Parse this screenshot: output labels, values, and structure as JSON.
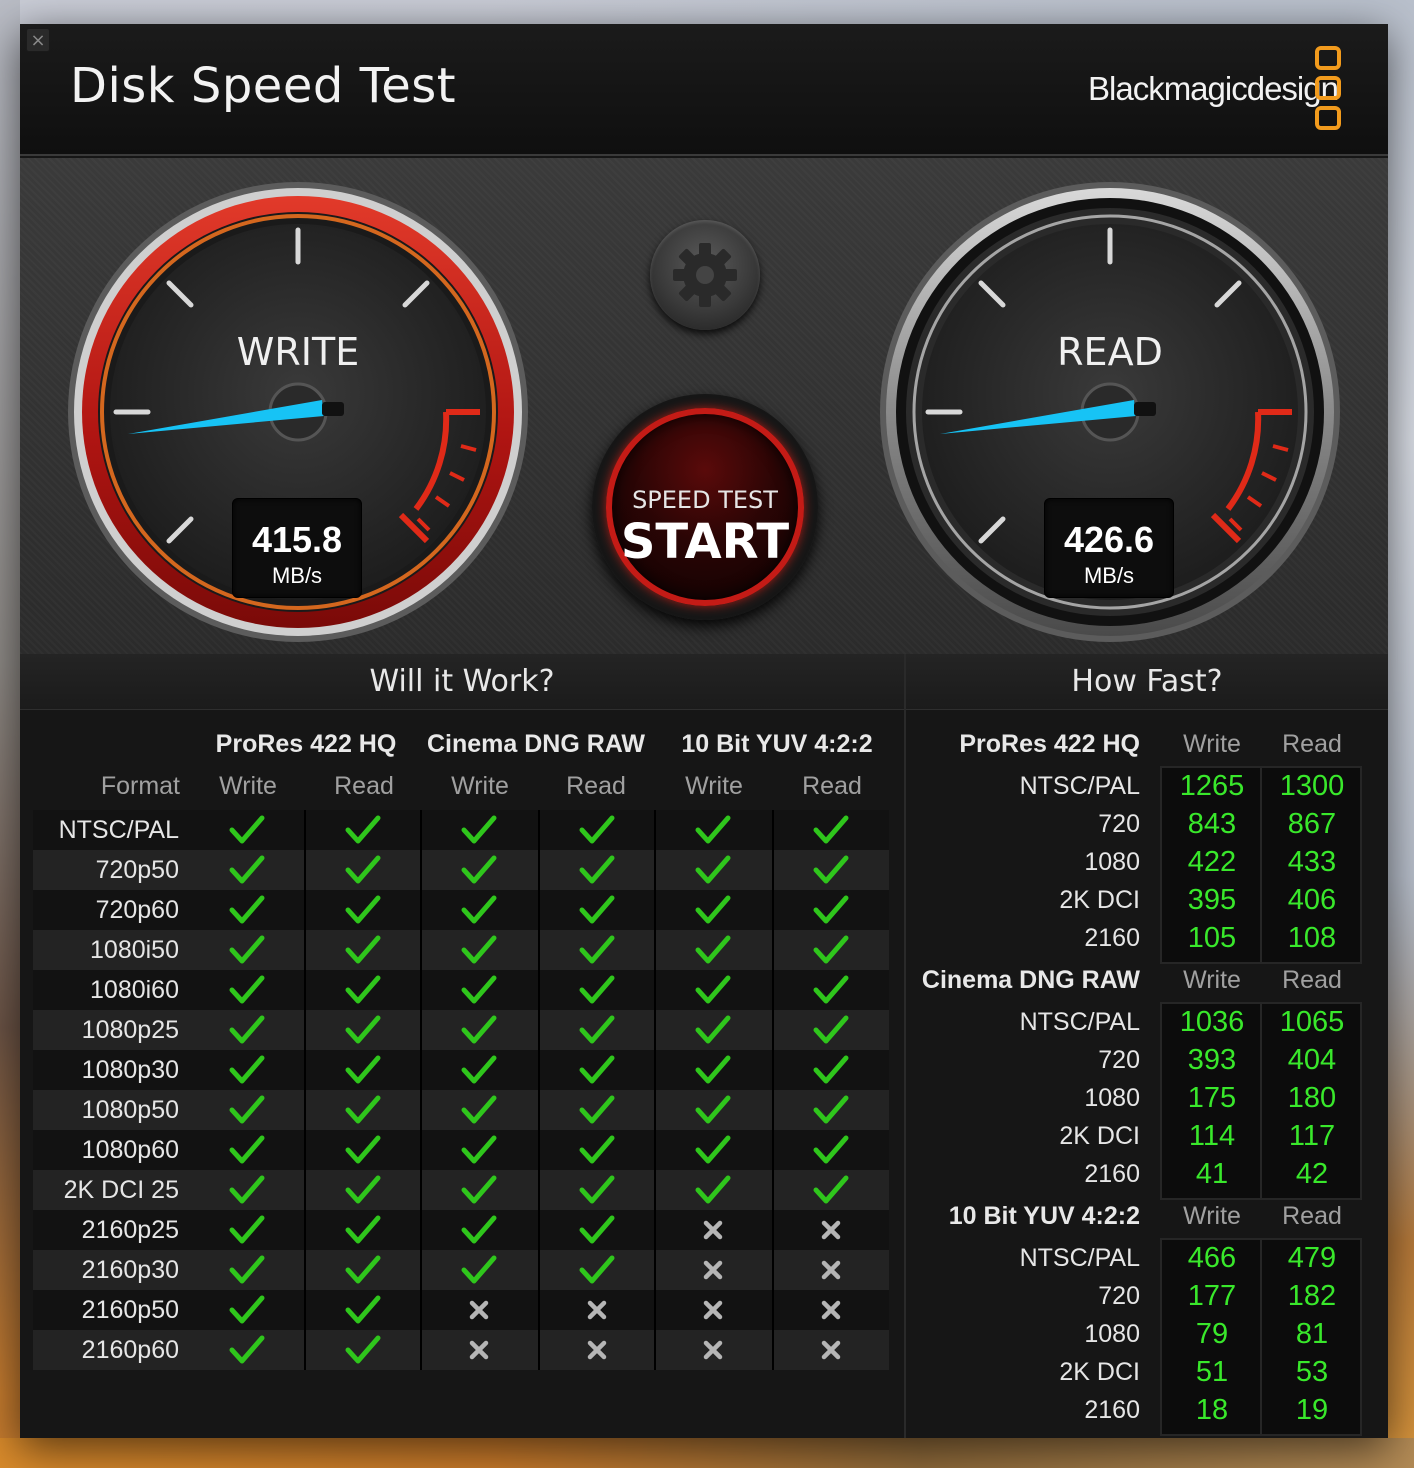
{
  "window": {
    "title": "Disk Speed Test",
    "brand": "Blackmagicdesign",
    "close_glyph": "×"
  },
  "colors": {
    "accent_orange": "#f29b1d",
    "needle_blue": "#17c3f5",
    "value_green": "#39e82b",
    "write_ring_red": "#c41b16"
  },
  "gauges": {
    "write": {
      "label": "WRITE",
      "value": "415.8",
      "unit": "MB/s"
    },
    "read": {
      "label": "READ",
      "value": "426.6",
      "unit": "MB/s"
    }
  },
  "buttons": {
    "settings_icon": "gear-icon",
    "start_sub": "SPEED TEST",
    "start_main": "START"
  },
  "will_it_work": {
    "title": "Will it Work?",
    "format_label": "Format",
    "groups": [
      "ProRes 422 HQ",
      "Cinema DNG RAW",
      "10 Bit YUV 4:2:2"
    ],
    "subcols": [
      "Write",
      "Read",
      "Write",
      "Read",
      "Write",
      "Read"
    ],
    "rows": [
      {
        "format": "NTSC/PAL",
        "status": [
          1,
          1,
          1,
          1,
          1,
          1
        ]
      },
      {
        "format": "720p50",
        "status": [
          1,
          1,
          1,
          1,
          1,
          1
        ]
      },
      {
        "format": "720p60",
        "status": [
          1,
          1,
          1,
          1,
          1,
          1
        ]
      },
      {
        "format": "1080i50",
        "status": [
          1,
          1,
          1,
          1,
          1,
          1
        ]
      },
      {
        "format": "1080i60",
        "status": [
          1,
          1,
          1,
          1,
          1,
          1
        ]
      },
      {
        "format": "1080p25",
        "status": [
          1,
          1,
          1,
          1,
          1,
          1
        ]
      },
      {
        "format": "1080p30",
        "status": [
          1,
          1,
          1,
          1,
          1,
          1
        ]
      },
      {
        "format": "1080p50",
        "status": [
          1,
          1,
          1,
          1,
          1,
          1
        ]
      },
      {
        "format": "1080p60",
        "status": [
          1,
          1,
          1,
          1,
          1,
          1
        ]
      },
      {
        "format": "2K DCI 25",
        "status": [
          1,
          1,
          1,
          1,
          1,
          1
        ]
      },
      {
        "format": "2160p25",
        "status": [
          1,
          1,
          1,
          1,
          0,
          0
        ]
      },
      {
        "format": "2160p30",
        "status": [
          1,
          1,
          1,
          1,
          0,
          0
        ]
      },
      {
        "format": "2160p50",
        "status": [
          1,
          1,
          0,
          0,
          0,
          0
        ]
      },
      {
        "format": "2160p60",
        "status": [
          1,
          1,
          0,
          0,
          0,
          0
        ]
      }
    ]
  },
  "how_fast": {
    "title": "How Fast?",
    "write_label": "Write",
    "read_label": "Read",
    "groups": [
      {
        "name": "ProRes 422 HQ",
        "rows": [
          {
            "format": "NTSC/PAL",
            "write": "1265",
            "read": "1300"
          },
          {
            "format": "720",
            "write": "843",
            "read": "867"
          },
          {
            "format": "1080",
            "write": "422",
            "read": "433"
          },
          {
            "format": "2K DCI",
            "write": "395",
            "read": "406"
          },
          {
            "format": "2160",
            "write": "105",
            "read": "108"
          }
        ]
      },
      {
        "name": "Cinema DNG RAW",
        "rows": [
          {
            "format": "NTSC/PAL",
            "write": "1036",
            "read": "1065"
          },
          {
            "format": "720",
            "write": "393",
            "read": "404"
          },
          {
            "format": "1080",
            "write": "175",
            "read": "180"
          },
          {
            "format": "2K DCI",
            "write": "114",
            "read": "117"
          },
          {
            "format": "2160",
            "write": "41",
            "read": "42"
          }
        ]
      },
      {
        "name": "10 Bit YUV 4:2:2",
        "rows": [
          {
            "format": "NTSC/PAL",
            "write": "466",
            "read": "479"
          },
          {
            "format": "720",
            "write": "177",
            "read": "182"
          },
          {
            "format": "1080",
            "write": "79",
            "read": "81"
          },
          {
            "format": "2K DCI",
            "write": "51",
            "read": "53"
          },
          {
            "format": "2160",
            "write": "18",
            "read": "19"
          }
        ]
      }
    ]
  }
}
